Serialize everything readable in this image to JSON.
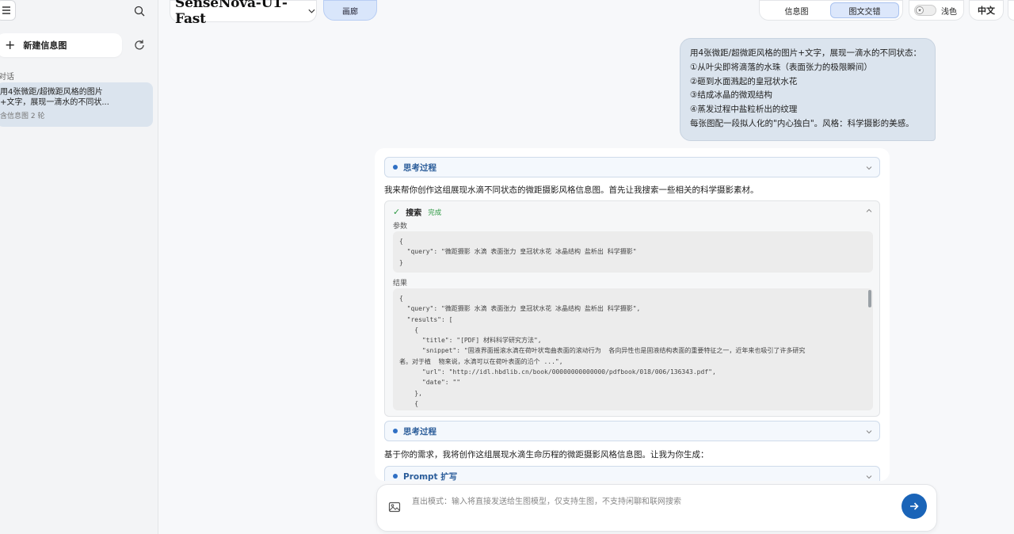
{
  "sidebar": {
    "new_button_label": "新建信息图",
    "section_label": "对话",
    "conversations": [
      {
        "title": "用4张微距/超微距风格的图片\n+文字，展现一滴水的不同状...",
        "meta": "含信息图  2 轮"
      }
    ]
  },
  "header": {
    "model_name": "SenseNova-U1-Fast",
    "gallery_label": "画廊",
    "mode_tabs": [
      "信息图",
      "图文交错"
    ],
    "active_mode": "图文交错",
    "theme_label": "浅色",
    "language_label": "中文"
  },
  "user_message": {
    "lines": [
      "用4张微距/超微距风格的图片+文字，展现一滴水的不同状态：",
      "①从叶尖即将滴落的水珠（表面张力的极限瞬间）",
      "②砸到水面溅起的皇冠状水花",
      "③结成冰晶的微观结构",
      "④蒸发过程中盐粒析出的纹理",
      "每张图配一段拟人化的\"内心独白\"。风格：科学摄影的美感。"
    ]
  },
  "assistant": {
    "think_label_1": "思考过程",
    "intro_text": "我来帮你创作这组展现水滴不同状态的微距摄影风格信息图。首先让我搜索一些相关的科学摄影素材。",
    "tool": {
      "name": "搜索",
      "status": "完成",
      "params_label": "参数",
      "params_lines": [
        "{",
        "  \"query\": \"微距摄影 水滴 表面张力 皇冠状水花 冰晶结构 盐析出 科学摄影\"",
        "}"
      ],
      "results_label": "结果",
      "results_lines": [
        "{",
        "  \"query\": \"微距摄影 水滴 表面张力 皇冠状水花 冰晶结构 盐析出 科学摄影\",",
        "  \"results\": [",
        "    {",
        "      \"title\": \"[PDF] 材料科学研究方法\",",
        "      \"snippet\": \"固液界面摇滚水滴在荷叶状弯曲表面的滚动行为  各向异性也是固液结构表面的重要特征之一，近年来也吸引了许多研究",
        "者。对于植  物来说，水滴可以在荷叶表面的沿个 ...\",",
        "      \"url\": \"http://idl.hbdlib.cn/book/00000000000000/pdfbook/018/006/136343.pdf\",",
        "      \"date\": \"\"",
        "    },",
        "    {"
      ]
    },
    "think_label_2": "思考过程",
    "followup_text": "基于你的需求，我将创作这组展现水滴生命历程的微距摄影风格信息图。让我为你生成：",
    "prompt_label": "Prompt 扩写"
  },
  "input": {
    "placeholder": "直出模式：输入将直接发送给生图模型，仅支持生图，不支持闲聊和联网搜索"
  },
  "colors": {
    "accent": "#1a64b8",
    "success": "#2f9a45",
    "user_bubble": "#dbe4ee"
  }
}
